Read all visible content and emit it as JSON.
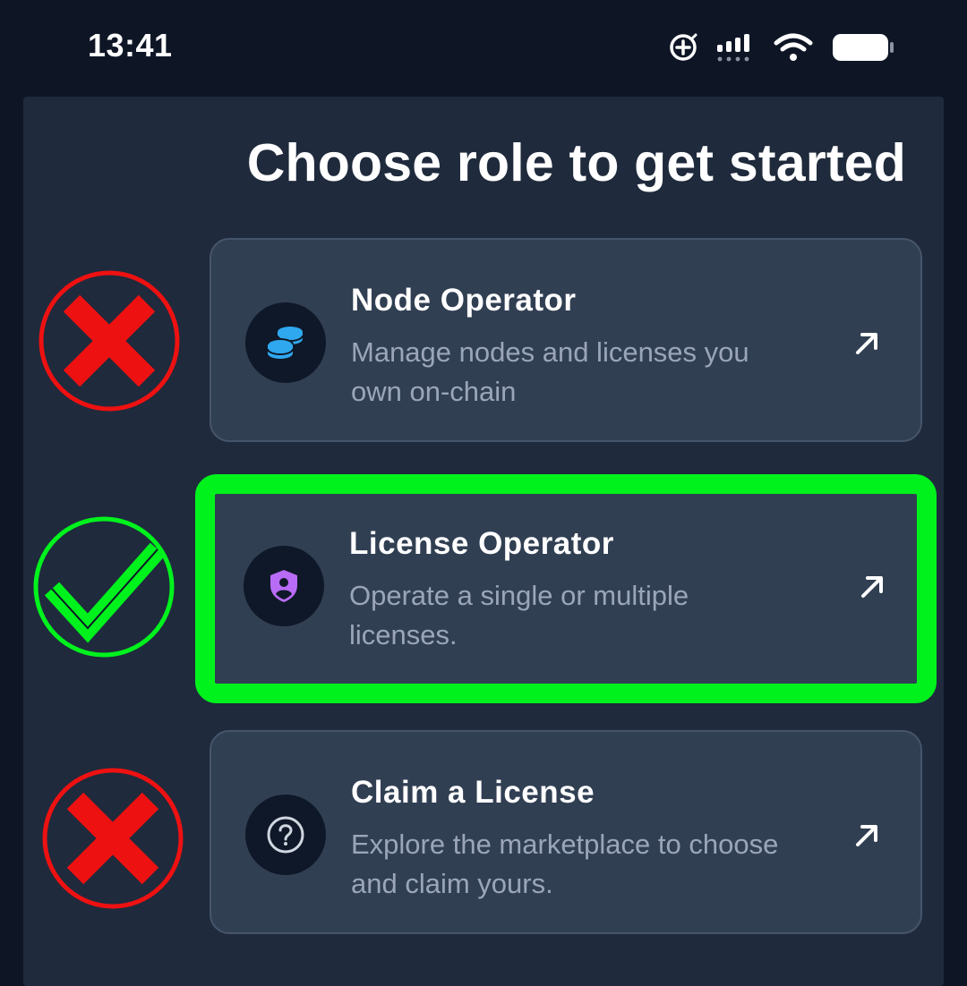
{
  "status_bar": {
    "time": "13:41"
  },
  "page": {
    "title": "Choose role to get started"
  },
  "roles": [
    {
      "title": "Node Operator",
      "description": "Manage nodes and licenses you own on-chain",
      "icon": "coins-stack-icon",
      "icon_color": "#2fa8f0",
      "annotation": "red-x"
    },
    {
      "title": "License Operator",
      "description": "Operate a single or multiple licenses.",
      "icon": "shield-user-icon",
      "icon_color": "#b86cf5",
      "annotation": "green-check",
      "highlighted": true
    },
    {
      "title": "Claim a License",
      "description": "Explore the marketplace to choose and claim yours.",
      "icon": "question-circle-icon",
      "icon_color": "#cfd6e0",
      "annotation": "red-x"
    }
  ],
  "colors": {
    "background": "#0e1626",
    "panel": "#1f2a3c",
    "card": "#313f53",
    "highlight": "#00f21d",
    "red_mark": "#ee1111",
    "green_mark": "#00f21d"
  }
}
